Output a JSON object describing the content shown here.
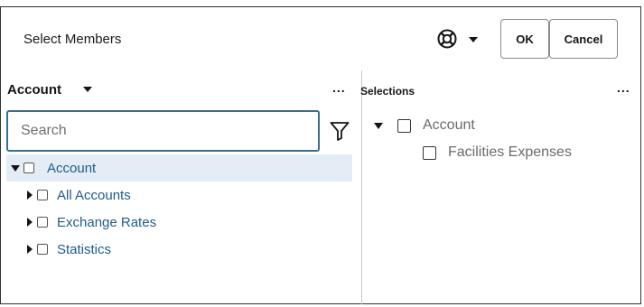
{
  "dialog": {
    "title": "Select Members",
    "ok_label": "OK",
    "cancel_label": "Cancel",
    "help_icon": "lifebuoy-icon"
  },
  "left_panel": {
    "dimension": "Account",
    "more_label": "...",
    "search_placeholder": "Search",
    "tree": [
      {
        "label": "Account",
        "expanded": true,
        "selected": true
      },
      {
        "label": "All Accounts",
        "expanded": false
      },
      {
        "label": "Exchange Rates",
        "expanded": false
      },
      {
        "label": "Statistics",
        "expanded": false
      }
    ]
  },
  "right_panel": {
    "title": "Selections",
    "more_label": "...",
    "items": [
      {
        "label": "Account",
        "expanded": true
      },
      {
        "label": "Facilities Expenses"
      }
    ]
  },
  "colors": {
    "link": "#1f5b8c",
    "selected_row": "#e4edf5",
    "search_border": "#3a6e91"
  }
}
